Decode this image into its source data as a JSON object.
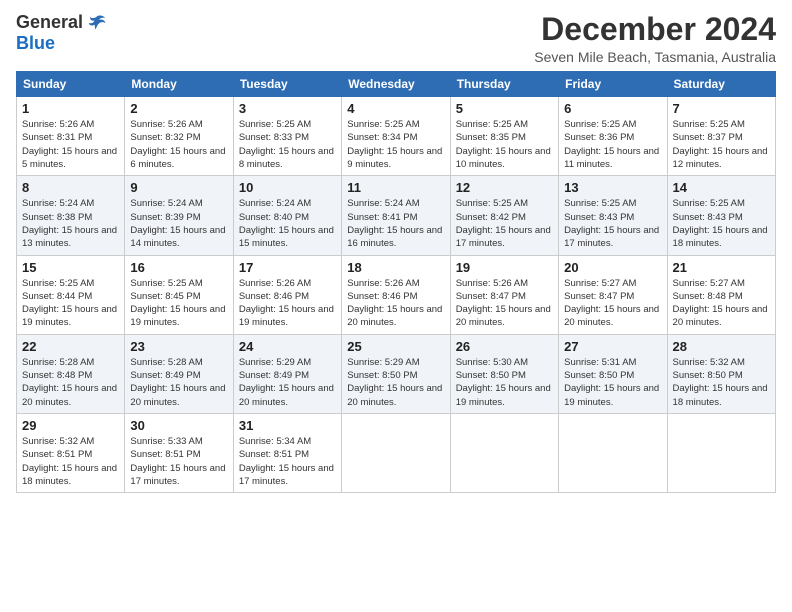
{
  "logo": {
    "general": "General",
    "blue": "Blue"
  },
  "title": {
    "month": "December 2024",
    "location": "Seven Mile Beach, Tasmania, Australia"
  },
  "weekdays": [
    "Sunday",
    "Monday",
    "Tuesday",
    "Wednesday",
    "Thursday",
    "Friday",
    "Saturday"
  ],
  "weeks": [
    [
      {
        "day": "1",
        "sunrise": "5:26 AM",
        "sunset": "8:31 PM",
        "daylight": "15 hours and 5 minutes."
      },
      {
        "day": "2",
        "sunrise": "5:26 AM",
        "sunset": "8:32 PM",
        "daylight": "15 hours and 6 minutes."
      },
      {
        "day": "3",
        "sunrise": "5:25 AM",
        "sunset": "8:33 PM",
        "daylight": "15 hours and 8 minutes."
      },
      {
        "day": "4",
        "sunrise": "5:25 AM",
        "sunset": "8:34 PM",
        "daylight": "15 hours and 9 minutes."
      },
      {
        "day": "5",
        "sunrise": "5:25 AM",
        "sunset": "8:35 PM",
        "daylight": "15 hours and 10 minutes."
      },
      {
        "day": "6",
        "sunrise": "5:25 AM",
        "sunset": "8:36 PM",
        "daylight": "15 hours and 11 minutes."
      },
      {
        "day": "7",
        "sunrise": "5:25 AM",
        "sunset": "8:37 PM",
        "daylight": "15 hours and 12 minutes."
      }
    ],
    [
      {
        "day": "8",
        "sunrise": "5:24 AM",
        "sunset": "8:38 PM",
        "daylight": "15 hours and 13 minutes."
      },
      {
        "day": "9",
        "sunrise": "5:24 AM",
        "sunset": "8:39 PM",
        "daylight": "15 hours and 14 minutes."
      },
      {
        "day": "10",
        "sunrise": "5:24 AM",
        "sunset": "8:40 PM",
        "daylight": "15 hours and 15 minutes."
      },
      {
        "day": "11",
        "sunrise": "5:24 AM",
        "sunset": "8:41 PM",
        "daylight": "15 hours and 16 minutes."
      },
      {
        "day": "12",
        "sunrise": "5:25 AM",
        "sunset": "8:42 PM",
        "daylight": "15 hours and 17 minutes."
      },
      {
        "day": "13",
        "sunrise": "5:25 AM",
        "sunset": "8:43 PM",
        "daylight": "15 hours and 17 minutes."
      },
      {
        "day": "14",
        "sunrise": "5:25 AM",
        "sunset": "8:43 PM",
        "daylight": "15 hours and 18 minutes."
      }
    ],
    [
      {
        "day": "15",
        "sunrise": "5:25 AM",
        "sunset": "8:44 PM",
        "daylight": "15 hours and 19 minutes."
      },
      {
        "day": "16",
        "sunrise": "5:25 AM",
        "sunset": "8:45 PM",
        "daylight": "15 hours and 19 minutes."
      },
      {
        "day": "17",
        "sunrise": "5:26 AM",
        "sunset": "8:46 PM",
        "daylight": "15 hours and 19 minutes."
      },
      {
        "day": "18",
        "sunrise": "5:26 AM",
        "sunset": "8:46 PM",
        "daylight": "15 hours and 20 minutes."
      },
      {
        "day": "19",
        "sunrise": "5:26 AM",
        "sunset": "8:47 PM",
        "daylight": "15 hours and 20 minutes."
      },
      {
        "day": "20",
        "sunrise": "5:27 AM",
        "sunset": "8:47 PM",
        "daylight": "15 hours and 20 minutes."
      },
      {
        "day": "21",
        "sunrise": "5:27 AM",
        "sunset": "8:48 PM",
        "daylight": "15 hours and 20 minutes."
      }
    ],
    [
      {
        "day": "22",
        "sunrise": "5:28 AM",
        "sunset": "8:48 PM",
        "daylight": "15 hours and 20 minutes."
      },
      {
        "day": "23",
        "sunrise": "5:28 AM",
        "sunset": "8:49 PM",
        "daylight": "15 hours and 20 minutes."
      },
      {
        "day": "24",
        "sunrise": "5:29 AM",
        "sunset": "8:49 PM",
        "daylight": "15 hours and 20 minutes."
      },
      {
        "day": "25",
        "sunrise": "5:29 AM",
        "sunset": "8:50 PM",
        "daylight": "15 hours and 20 minutes."
      },
      {
        "day": "26",
        "sunrise": "5:30 AM",
        "sunset": "8:50 PM",
        "daylight": "15 hours and 19 minutes."
      },
      {
        "day": "27",
        "sunrise": "5:31 AM",
        "sunset": "8:50 PM",
        "daylight": "15 hours and 19 minutes."
      },
      {
        "day": "28",
        "sunrise": "5:32 AM",
        "sunset": "8:50 PM",
        "daylight": "15 hours and 18 minutes."
      }
    ],
    [
      {
        "day": "29",
        "sunrise": "5:32 AM",
        "sunset": "8:51 PM",
        "daylight": "15 hours and 18 minutes."
      },
      {
        "day": "30",
        "sunrise": "5:33 AM",
        "sunset": "8:51 PM",
        "daylight": "15 hours and 17 minutes."
      },
      {
        "day": "31",
        "sunrise": "5:34 AM",
        "sunset": "8:51 PM",
        "daylight": "15 hours and 17 minutes."
      },
      null,
      null,
      null,
      null
    ]
  ]
}
